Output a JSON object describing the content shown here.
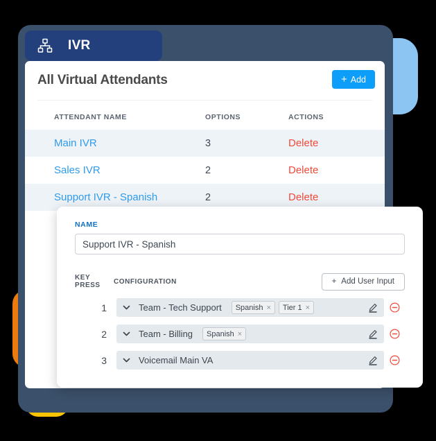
{
  "decorations": {
    "blue": "#8dc5f2",
    "orange": "#eb7b0f",
    "yellow": "#fbc403",
    "navy_panel": "#3b506a",
    "tab_blue": "#24407c"
  },
  "tab": {
    "label": "IVR",
    "icon": "sitemap-icon"
  },
  "card": {
    "title": "All Virtual Attendants",
    "add_button": {
      "label": "Add",
      "plus": "+",
      "color": "#0d9ef9"
    },
    "table": {
      "columns": [
        "ATTENDANT NAME",
        "OPTIONS",
        "ACTIONS"
      ],
      "rows": [
        {
          "name": "Main IVR",
          "options": "3",
          "action": "Delete"
        },
        {
          "name": "Sales IVR",
          "options": "2",
          "action": "Delete"
        },
        {
          "name": "Support IVR - Spanish",
          "options": "2",
          "action": "Delete"
        }
      ],
      "link_color": "#2f9bec",
      "delete_color": "#f04a3a"
    }
  },
  "modal": {
    "name_label": "NAME",
    "name_value": "Support IVR - Spanish",
    "name_placeholder": "Name",
    "headers": {
      "key_press": "KEY PRESS",
      "configuration": "CONFIGURATION"
    },
    "add_user_input": {
      "label": "Add User Input",
      "plus": "+"
    },
    "rows": [
      {
        "key": "1",
        "target": "Team - Tech Support",
        "tags": [
          {
            "label": "Spanish",
            "remove": "×"
          },
          {
            "label": "Tier 1",
            "remove": "×"
          }
        ]
      },
      {
        "key": "2",
        "target": "Team - Billing",
        "tags": [
          {
            "label": "Spanish",
            "remove": "×"
          }
        ]
      },
      {
        "key": "3",
        "target": "Voicemail Main VA",
        "tags": []
      }
    ]
  }
}
